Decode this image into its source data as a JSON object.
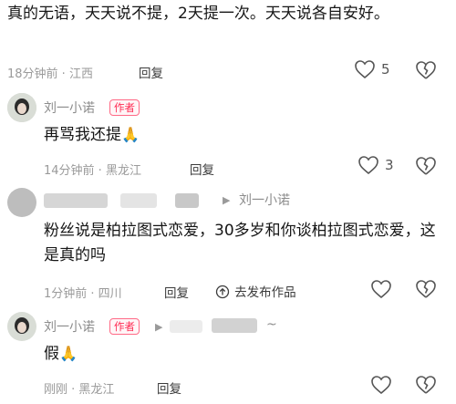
{
  "comment1": {
    "text": "真的无语，天天说不提，2天提一次。天天说各自安好。",
    "time": "18分钟前 · 江西",
    "reply": "回复",
    "likes": "5"
  },
  "comment2": {
    "author": "刘一小诺",
    "badge": "作者",
    "text": "再骂我还提",
    "emoji": "🙏",
    "time": "14分钟前 · 黑龙江",
    "reply": "回复",
    "likes": "3"
  },
  "comment3": {
    "reply_to": "刘一小诺",
    "text": "粉丝说是柏拉图式恋爱，30多岁和你谈柏拉图式恋爱，这是真的吗",
    "time": "1分钟前 · 四川",
    "reply": "回复",
    "go_publish": "去发布作品"
  },
  "comment4": {
    "author": "刘一小诺",
    "badge": "作者",
    "reply_to_suffix": "~",
    "text": "假",
    "emoji": "🙏",
    "time": "刚刚 · 黑龙江",
    "reply": "回复"
  },
  "colors": {
    "accent": "#ff2d55",
    "meta": "#9a9a9a"
  }
}
